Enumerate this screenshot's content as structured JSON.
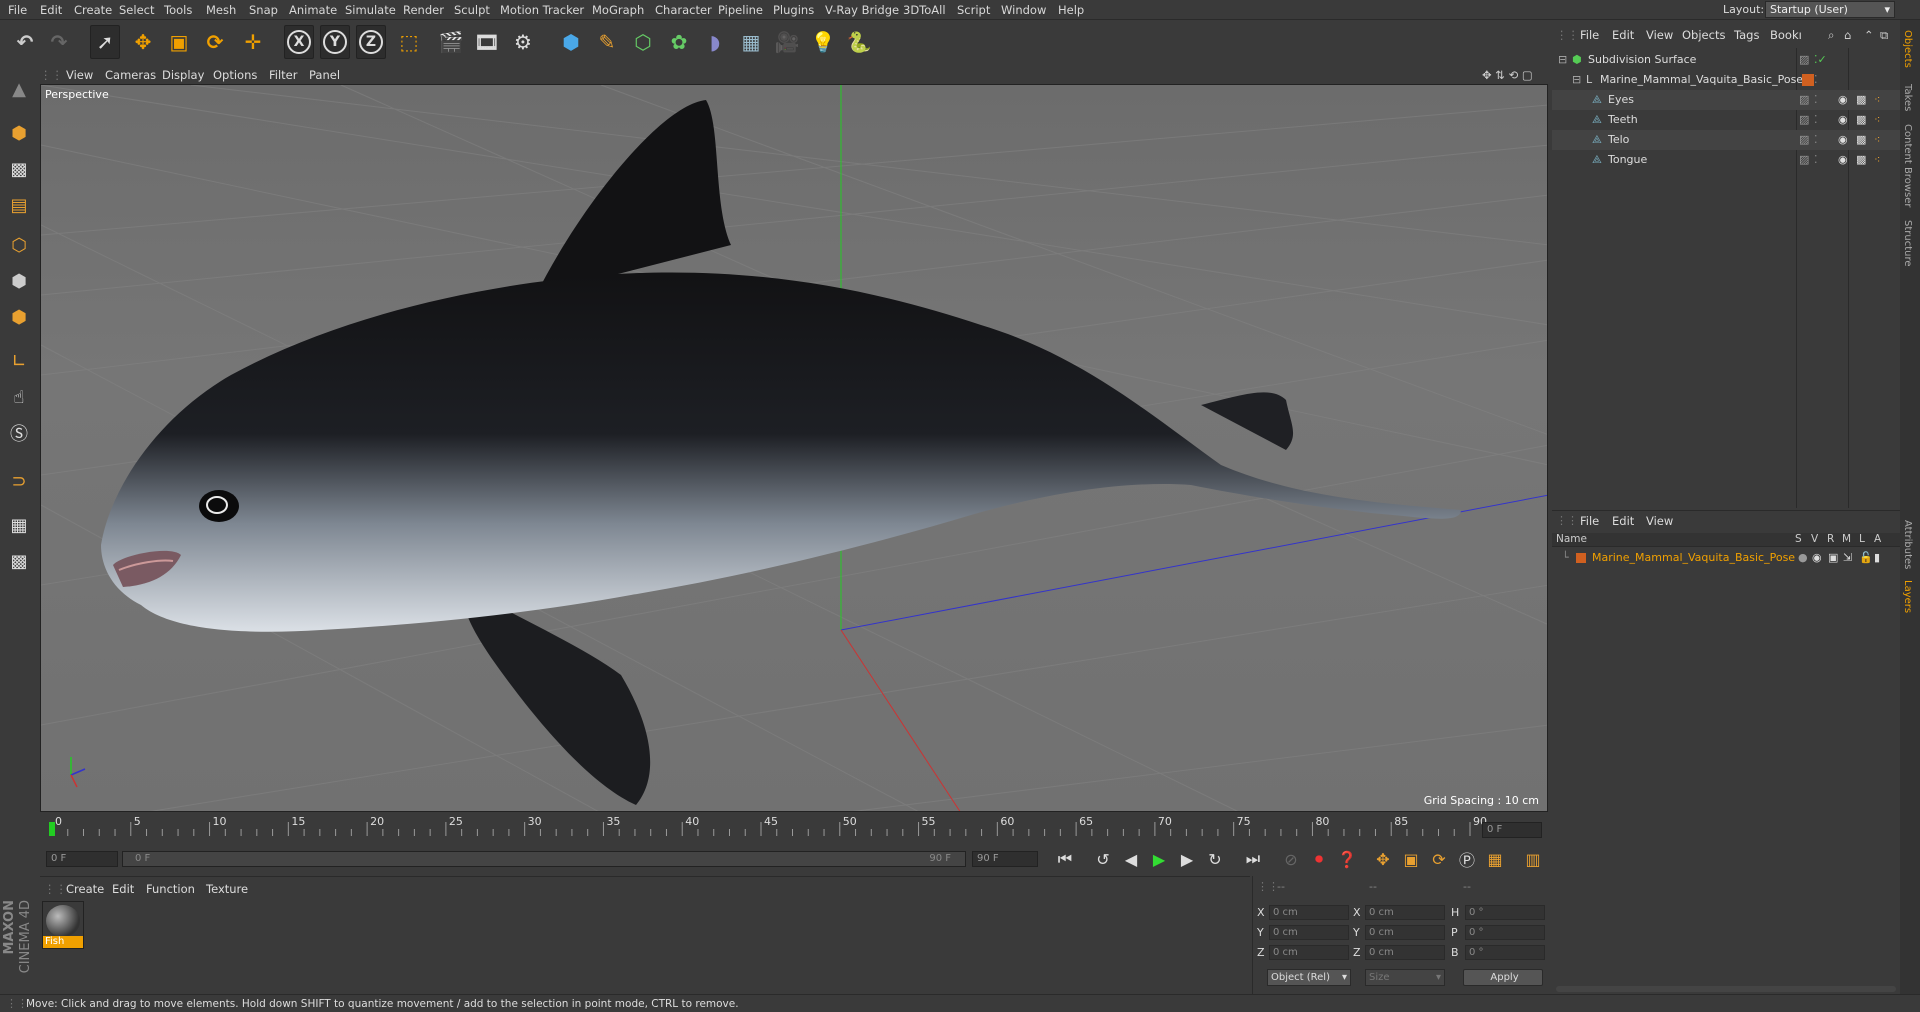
{
  "menubar": {
    "items": [
      "File",
      "Edit",
      "Create",
      "Select",
      "Tools",
      "Mesh",
      "Snap",
      "Animate",
      "Simulate",
      "Render",
      "Sculpt",
      "Motion Tracker",
      "MoGraph",
      "Character",
      "Pipeline",
      "Plugins",
      "V-Ray Bridge",
      "3DToAll",
      "Script",
      "Window",
      "Help"
    ],
    "layout_label": "Layout:",
    "layout_value": "Startup (User)"
  },
  "toolbar": {
    "icons": [
      "undo-icon",
      "redo-icon",
      "select-arrow-icon",
      "move-icon",
      "scale-icon",
      "rotate-icon",
      "live-select-icon",
      "x-axis-icon",
      "y-axis-icon",
      "z-axis-icon",
      "coordinate-system-icon",
      "render-view-icon",
      "render-picture-viewer-icon",
      "render-settings-icon",
      "cube-icon",
      "pen-icon",
      "nurbs-icon",
      "array-icon",
      "deformer-icon",
      "floor-icon",
      "camera-icon",
      "light-icon",
      "python-icon"
    ],
    "axis_x": "X",
    "axis_y": "Y",
    "axis_z": "Z"
  },
  "viewport": {
    "menu": [
      "View",
      "Cameras",
      "Display",
      "Options",
      "Filter",
      "Panel"
    ],
    "label": "Perspective",
    "grid_spacing": "Grid Spacing : 10 cm"
  },
  "timeline": {
    "ticks": [
      "0",
      "5",
      "10",
      "15",
      "20",
      "25",
      "30",
      "35",
      "40",
      "45",
      "50",
      "55",
      "60",
      "65",
      "70",
      "75",
      "80",
      "85",
      "90"
    ],
    "current_frame": "0 F",
    "start_field": "0 F",
    "slider_start": "0 F",
    "slider_end": "90 F",
    "end_field": "90 F"
  },
  "material_panel": {
    "menu": [
      "Create",
      "Edit",
      "Function",
      "Texture"
    ],
    "material_name": "Fish"
  },
  "coordinates": {
    "header_dashes": [
      "--",
      "--",
      "--"
    ],
    "rows": [
      {
        "a": "X",
        "av": "0 cm",
        "b": "X",
        "bv": "0 cm",
        "c": "H",
        "cv": "0 °"
      },
      {
        "a": "Y",
        "av": "0 cm",
        "b": "Y",
        "bv": "0 cm",
        "c": "P",
        "cv": "0 °"
      },
      {
        "a": "Z",
        "av": "0 cm",
        "b": "Z",
        "bv": "0 cm",
        "c": "B",
        "cv": "0 °"
      }
    ],
    "mode_select": "Object (Rel)",
    "size_select": "Size",
    "apply_label": "Apply"
  },
  "objects_panel": {
    "menu": [
      "File",
      "Edit",
      "View",
      "Objects",
      "Tags",
      "Bookı"
    ],
    "items": [
      {
        "name": "Subdivision Surface",
        "indent": 0
      },
      {
        "name": "Marine_Mammal_Vaquita_Basic_Pose",
        "indent": 1
      },
      {
        "name": "Eyes",
        "indent": 2
      },
      {
        "name": "Teeth",
        "indent": 2
      },
      {
        "name": "Telo",
        "indent": 2
      },
      {
        "name": "Tongue",
        "indent": 2
      }
    ]
  },
  "layers_panel": {
    "menu": [
      "File",
      "Edit",
      "View"
    ],
    "columns": [
      "Name",
      "S",
      "V",
      "R",
      "M",
      "L",
      "A"
    ],
    "layer_name": "Marine_Mammal_Vaquita_Basic_Pose",
    "layer_color": "#d06020"
  },
  "right_tabs": [
    "Objects",
    "Takes",
    "Content Browser",
    "Structure",
    "Attributes",
    "Layers"
  ],
  "logo": {
    "brand": "MAXON",
    "product": "CINEMA 4D"
  },
  "status": "Move: Click and drag to move elements. Hold down SHIFT to quantize movement / add to the selection in point mode, CTRL to remove.",
  "colors": {
    "accent_orange": "#f0a000",
    "highlight": "#e8a000",
    "axis_x": "#c03030",
    "axis_y": "#30c030",
    "axis_z": "#3040d0"
  }
}
